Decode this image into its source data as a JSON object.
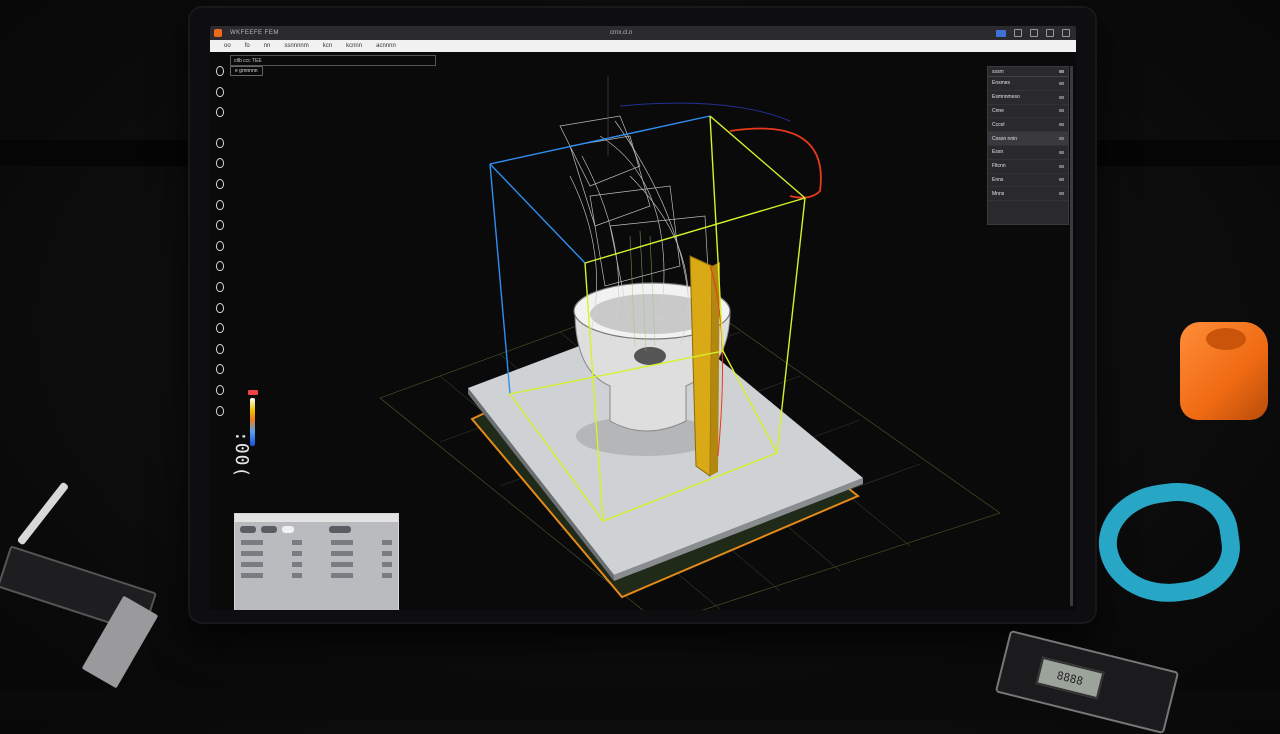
{
  "window": {
    "app_name": "WKFEEFE FEM",
    "doc_title": "crnx.cl.n"
  },
  "menu": [
    "oo",
    "fo",
    "nn",
    "ssnnnnm",
    "kcn",
    "kcnnn",
    "acnnnn"
  ],
  "subtoolbar": {
    "breadcrumb": "ctlb ccc TEE",
    "selection": "e grnnnnn"
  },
  "left_tools": [
    "move-icon",
    "rotate-icon",
    "scale-icon",
    "select-icon",
    "cut-icon",
    "mirror-icon",
    "support-icon",
    "seam-icon",
    "paint-icon",
    "measure-icon",
    "layer-icon",
    "text-icon",
    "slice-icon",
    "preview-icon",
    "camera-icon",
    "settings-icon",
    "help-icon"
  ],
  "color_scale": {
    "label": ":00("
  },
  "right_panel": {
    "header": "sssm",
    "rows": [
      "Ensmes",
      "Esmnnmeso",
      "Cnne",
      "Cccel",
      "Cossn nnin",
      "Essn",
      "Fltcnn",
      "Enns",
      "Mnns"
    ]
  },
  "caliper_readout": "8888",
  "colors": {
    "bbox_blue": "#2f8ff0",
    "bbox_yellow": "#d8f22a",
    "path_red": "#e8391a",
    "bed_edge_orange": "#e58a1a",
    "support_gold": "#d9a916",
    "accent_orange": "#ef6a1f"
  }
}
